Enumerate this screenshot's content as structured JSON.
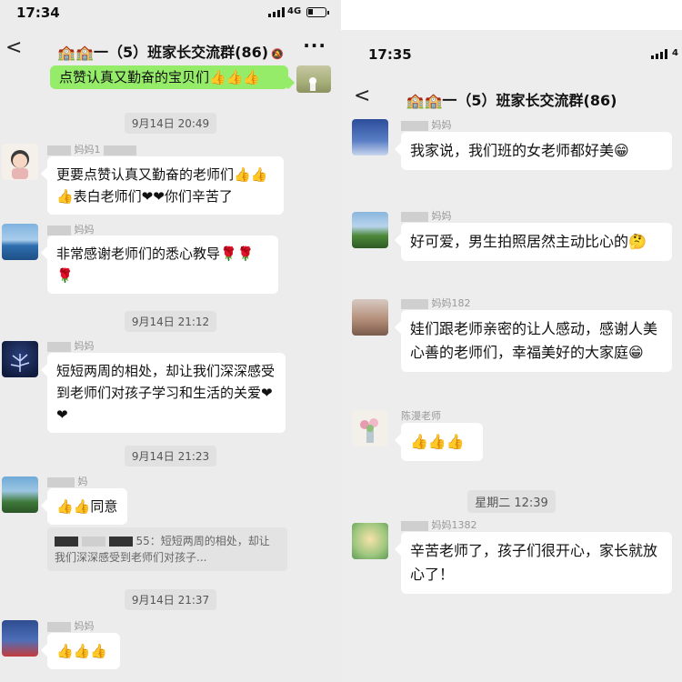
{
  "left": {
    "status": {
      "time": "17:34",
      "network": "4G"
    },
    "nav": {
      "back": "<",
      "title": "🏫🏫一（5）班家长交流群(86)",
      "more": "···",
      "mute_icon": "bell-off-icon"
    },
    "messages": {
      "m0": {
        "text": "点赞认真又勤奋的宝贝们👍👍👍"
      },
      "t1": "9月14日 20:49",
      "m1": {
        "sender": "妈妈1",
        "text": "更要点赞认真又勤奋的老师们👍👍👍表白老师们❤❤你们辛苦了"
      },
      "m2": {
        "sender": "妈妈",
        "text": "非常感谢老师们的悉心教导🌹🌹🌹"
      },
      "t2": "9月14日 21:12",
      "m3": {
        "sender": "妈妈",
        "text": "短短两周的相处，却让我们深深感受到老师们对孩子学习和生活的关爱❤❤"
      },
      "t3": "9月14日 21:23",
      "m4": {
        "sender": "妈",
        "text": "👍👍同意",
        "quote": "55：短短两周的相处，却让我们深深感受到老师们对孩子..."
      },
      "t4": "9月14日 21:37",
      "m5": {
        "sender": "妈妈",
        "text": "👍👍👍"
      }
    }
  },
  "right": {
    "status": {
      "time": "17:35",
      "network": "4"
    },
    "nav": {
      "back": "<",
      "title": "🏫🏫一（5）班家长交流群(86)"
    },
    "messages": {
      "m1": {
        "sender": "妈妈",
        "text": "我家说，我们班的女老师都好美😁"
      },
      "m2": {
        "sender": "妈妈",
        "text": "好可爱，男生拍照居然主动比心的🤔"
      },
      "m3": {
        "sender": "妈妈182",
        "text": "娃们跟老师亲密的让人感动，感谢人美心善的老师们，幸福美好的大家庭😁"
      },
      "m4": {
        "sender": "陈漫老师",
        "text": "👍👍👍"
      },
      "t1": "星期二 12:39",
      "m5": {
        "sender": "妈妈1382",
        "text": "辛苦老师了，孩子们很开心，家长就放心了！"
      }
    }
  }
}
